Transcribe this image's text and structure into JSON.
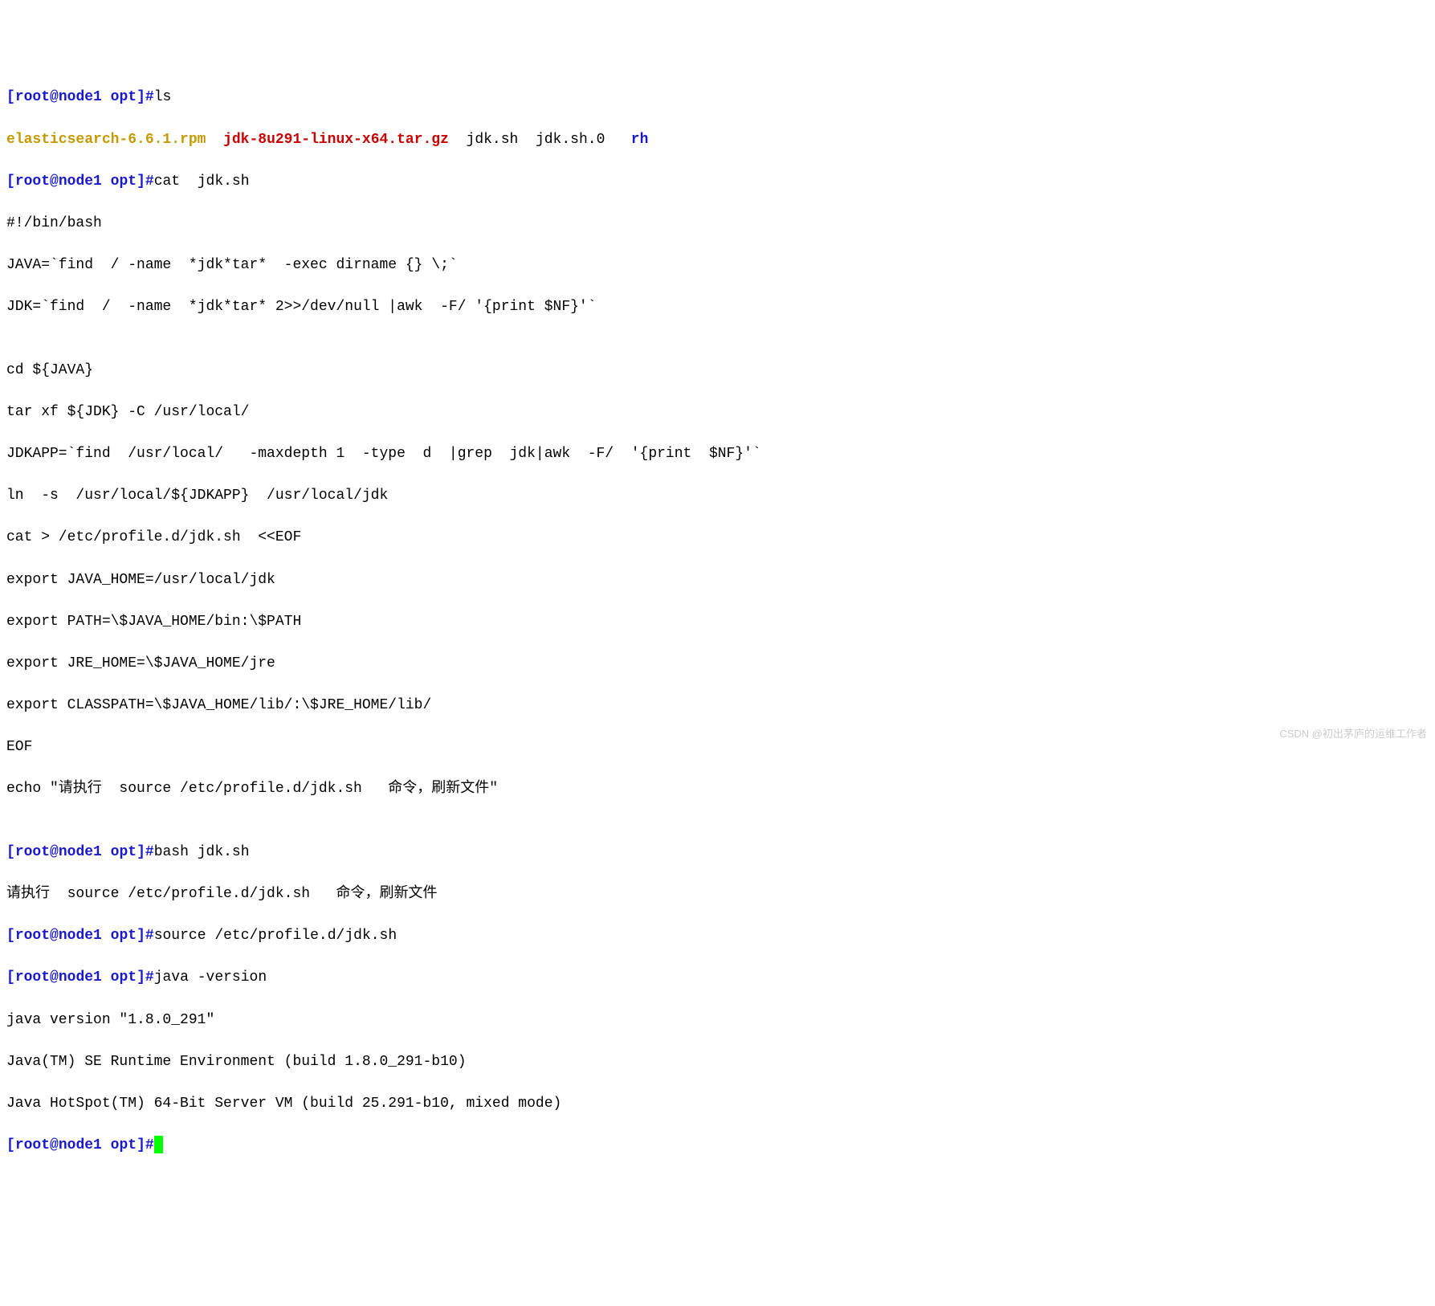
{
  "prompt": {
    "open": "[",
    "user": "root",
    "at": "@",
    "host": "node1",
    "space": " ",
    "path": "opt",
    "close": "]",
    "hash": "#"
  },
  "commands": {
    "ls": "ls",
    "cat_jdksh": "cat  jdk.sh",
    "bash_jdksh": "bash jdk.sh",
    "source_profile": "source /etc/profile.d/jdk.sh",
    "java_version": "java -version"
  },
  "ls_output": {
    "file1": "elasticsearch-6.6.1.rpm",
    "gap1": "  ",
    "file2": "jdk-8u291-linux-x64.tar.gz",
    "gap2": "  ",
    "file3": "jdk.sh",
    "gap3": "  ",
    "file4": "jdk.sh.0",
    "gap4": "   ",
    "file5": "rh"
  },
  "script": {
    "l1": "#!/bin/bash",
    "l2": "JAVA=`find  / -name  *jdk*tar*  -exec dirname {} \\;`",
    "l3": "JDK=`find  /  -name  *jdk*tar* 2>>/dev/null |awk  -F/ '{print $NF}'`",
    "l4": "",
    "l5": "cd ${JAVA}",
    "l6": "tar xf ${JDK} -C /usr/local/",
    "l7": "JDKAPP=`find  /usr/local/   -maxdepth 1  -type  d  |grep  jdk|awk  -F/  '{print  $NF}'`",
    "l8": "ln  -s  /usr/local/${JDKAPP}  /usr/local/jdk",
    "l9": "cat > /etc/profile.d/jdk.sh  <<EOF",
    "l10": "export JAVA_HOME=/usr/local/jdk",
    "l11": "export PATH=\\$JAVA_HOME/bin:\\$PATH",
    "l12": "export JRE_HOME=\\$JAVA_HOME/jre",
    "l13": "export CLASSPATH=\\$JAVA_HOME/lib/:\\$JRE_HOME/lib/",
    "l14": "EOF",
    "l15": "echo \"请执行  source /etc/profile.d/jdk.sh   命令，刷新文件\"",
    "l16": ""
  },
  "bash_out": "请执行  source /etc/profile.d/jdk.sh   命令，刷新文件",
  "java_out": {
    "l1": "java version \"1.8.0_291\"",
    "l2": "Java(TM) SE Runtime Environment (build 1.8.0_291-b10)",
    "l3": "Java HotSpot(TM) 64-Bit Server VM (build 25.291-b10, mixed mode)"
  },
  "watermark": "CSDN @初出茅庐的运维工作者"
}
